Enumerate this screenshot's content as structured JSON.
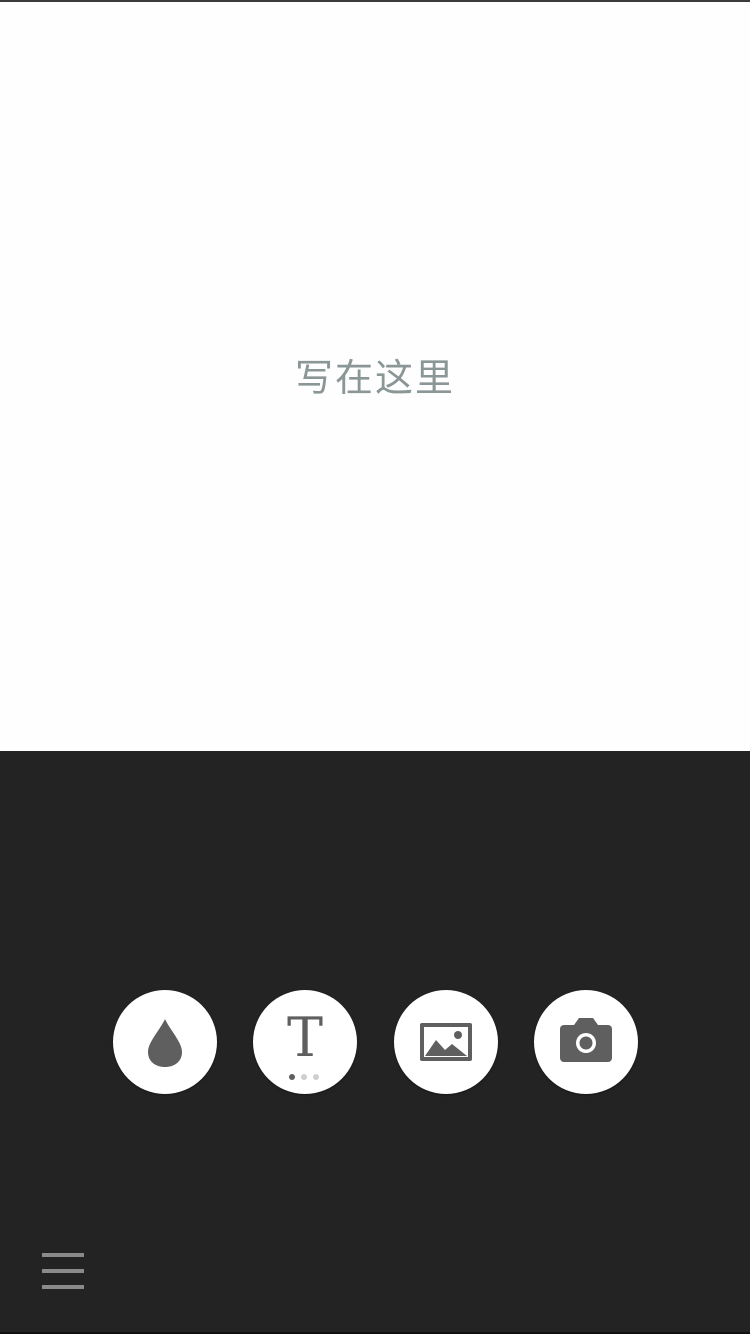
{
  "editor": {
    "placeholder": "写在这里",
    "placeholder_color": "#8b9696"
  },
  "toolbar": {
    "background": "#232323",
    "tools": [
      {
        "name": "ink-drop-icon"
      },
      {
        "name": "text-style-icon",
        "glyph": "T",
        "page_count": 3,
        "active_page": 1
      },
      {
        "name": "image-icon"
      },
      {
        "name": "camera-icon"
      }
    ],
    "icon_color": "#5f5f5f"
  },
  "menu": {
    "icon": "hamburger-menu-icon",
    "color": "#8a8a8a"
  }
}
